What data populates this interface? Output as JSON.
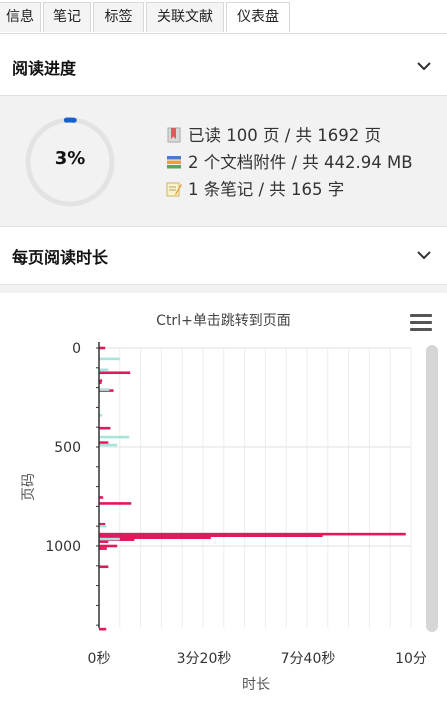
{
  "tabs": [
    {
      "label": "信息"
    },
    {
      "label": "笔记"
    },
    {
      "label": "标签"
    },
    {
      "label": "关联文献"
    },
    {
      "label": "仪表盘"
    }
  ],
  "active_tab": "仪表盘",
  "progress_section": {
    "title": "阅读进度",
    "percent_label": "3%",
    "percent": 0.03,
    "stats": [
      {
        "text": "已读 100 页 / 共 1692 页",
        "icon": "bookmark-icon"
      },
      {
        "text": "2 个文档附件 / 共 442.94 MB",
        "icon": "books-icon"
      },
      {
        "text": "1 条笔记 / 共 165 字",
        "icon": "memo-icon"
      }
    ]
  },
  "time_section": {
    "title": "每页阅读时长"
  },
  "colors": {
    "accent_blue": "#1a5fd1",
    "bar_red": "#e0185e",
    "bar_teal": "#a8e4db"
  },
  "chart_data": {
    "type": "bar",
    "orientation": "horizontal",
    "title": "Ctrl+单击跳转到页面",
    "xlabel": "时长",
    "ylabel": "页码",
    "x_ticks": [
      "0秒",
      "3分20秒",
      "7分40秒",
      "10分"
    ],
    "x_tick_values": [
      0,
      200,
      460,
      600
    ],
    "y_ticks": [
      "0",
      "500",
      "1000"
    ],
    "y_tick_values": [
      0,
      500,
      1000
    ],
    "xlim": [
      0,
      600
    ],
    "ylim": [
      -30,
      1440
    ],
    "series": [
      {
        "color": "#e0185e",
        "bars": [
          {
            "page": 0,
            "seconds": 12
          },
          {
            "page": 125,
            "seconds": 60
          },
          {
            "page": 165,
            "seconds": 6
          },
          {
            "page": 175,
            "seconds": 5
          },
          {
            "page": 215,
            "seconds": 28
          },
          {
            "page": 405,
            "seconds": 22
          },
          {
            "page": 478,
            "seconds": 18
          },
          {
            "page": 755,
            "seconds": 8
          },
          {
            "page": 785,
            "seconds": 62
          },
          {
            "page": 890,
            "seconds": 12
          },
          {
            "page": 940,
            "seconds": 590
          },
          {
            "page": 948,
            "seconds": 430
          },
          {
            "page": 958,
            "seconds": 215
          },
          {
            "page": 968,
            "seconds": 68
          },
          {
            "page": 978,
            "seconds": 18
          },
          {
            "page": 1000,
            "seconds": 35
          },
          {
            "page": 1013,
            "seconds": 15
          },
          {
            "page": 1105,
            "seconds": 18
          },
          {
            "page": 1420,
            "seconds": 14
          }
        ]
      },
      {
        "color": "#a8e4db",
        "bars": [
          {
            "page": 55,
            "seconds": 40
          },
          {
            "page": 110,
            "seconds": 18
          },
          {
            "page": 210,
            "seconds": 20
          },
          {
            "page": 340,
            "seconds": 6
          },
          {
            "page": 450,
            "seconds": 58
          },
          {
            "page": 490,
            "seconds": 35
          },
          {
            "page": 900,
            "seconds": 14
          },
          {
            "page": 965,
            "seconds": 40
          }
        ]
      }
    ]
  }
}
